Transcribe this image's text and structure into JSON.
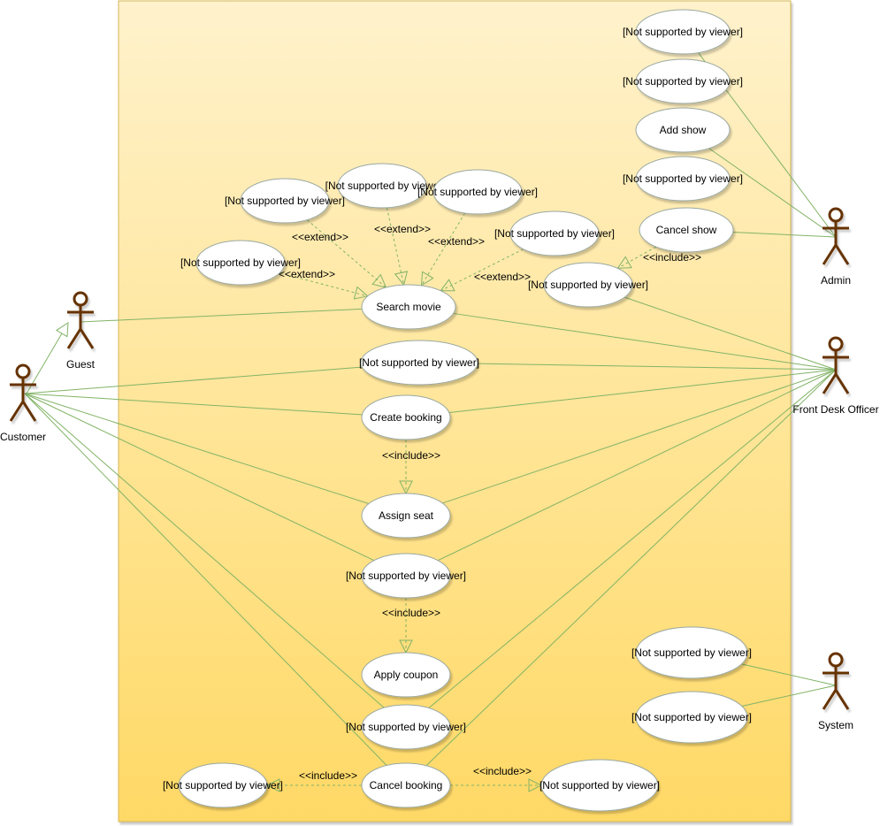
{
  "colors": {
    "frame_top": "#fff2cc",
    "frame_bottom": "#ffd966",
    "frame_border": "#d6b656",
    "line": "#82b366",
    "actor": "#663300",
    "ellipse_stroke": "#9aa8a0"
  },
  "actors": [
    {
      "name": "Guest"
    },
    {
      "name": "Customer"
    },
    {
      "name": "Admin"
    },
    {
      "name": "Front Desk Officer"
    },
    {
      "name": "System"
    }
  ],
  "use_cases": [
    {
      "label": "[Not supported by viewer]"
    },
    {
      "label": "[Not supported by viewer]"
    },
    {
      "label": "Add show"
    },
    {
      "label": "[Not supported by viewer]"
    },
    {
      "label": "Cancel show"
    },
    {
      "label": "[Not supported by viewer]"
    },
    {
      "label": "[Not supported by viewe"
    },
    {
      "label": "[Not supported by viewer]"
    },
    {
      "label": "[Not supported by viewer]"
    },
    {
      "label": "[Not supported by viewer]"
    },
    {
      "label": "[Not supported by viewer]"
    },
    {
      "label": "Search movie"
    },
    {
      "label": "[Not supported by viewer]"
    },
    {
      "label": "Create booking"
    },
    {
      "label": "Assign seat"
    },
    {
      "label": "[Not supported by viewer]"
    },
    {
      "label": "Apply coupon"
    },
    {
      "label": "[Not supported by viewer]"
    },
    {
      "label": "Cancel booking"
    },
    {
      "label": "[Not supported by viewer]"
    },
    {
      "label": "[Not supported by viewer]"
    },
    {
      "label": "[Not supported by viewer]"
    },
    {
      "label": "[Not supported by viewer]"
    }
  ],
  "relations": {
    "extend_label": "<<extend>>",
    "include_label": "<<include>>"
  }
}
